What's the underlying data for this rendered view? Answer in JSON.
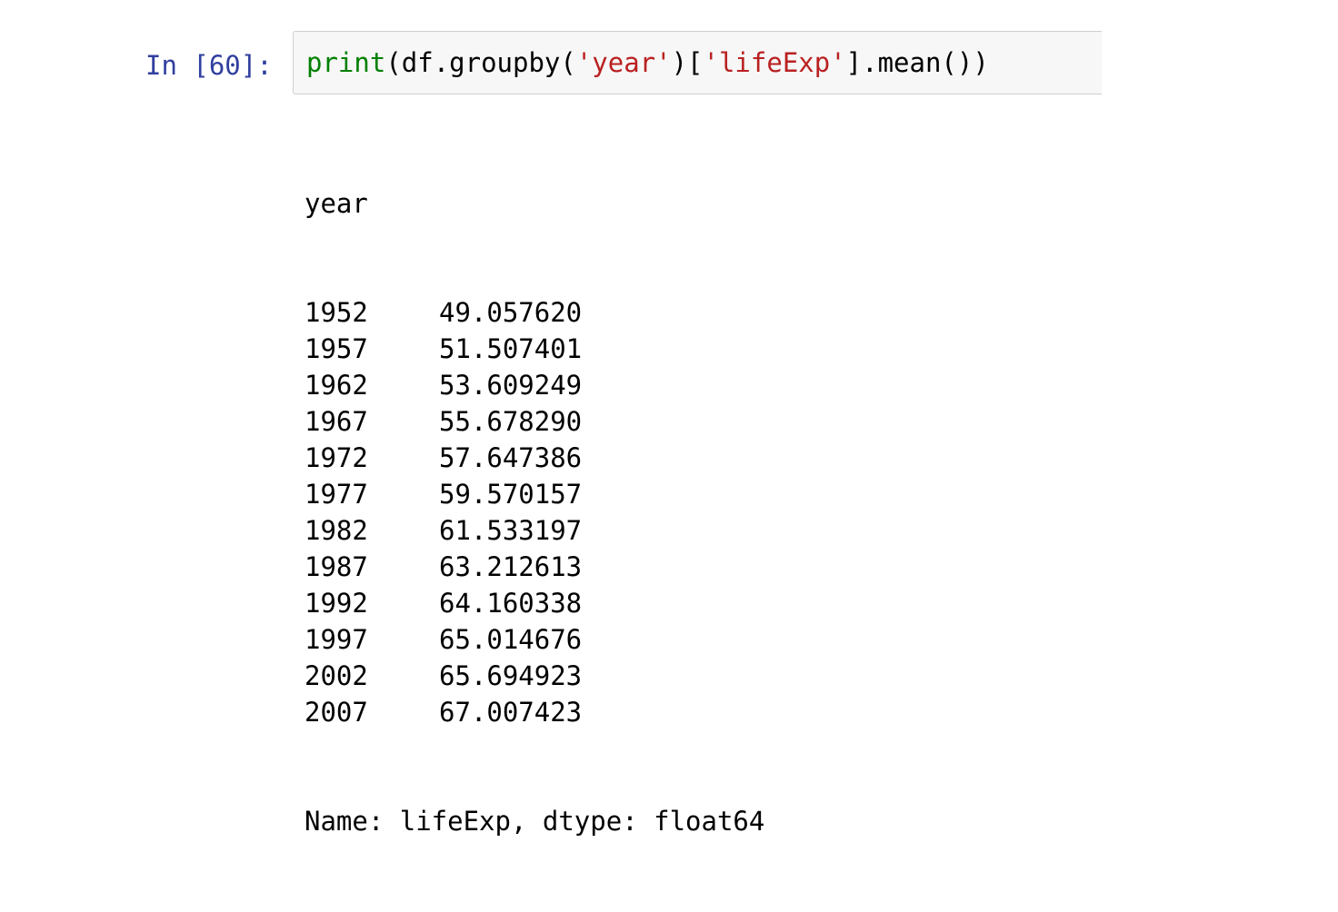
{
  "cell": {
    "prompt": "In [60]:",
    "code": {
      "fn": "print",
      "part1": "(df.groupby(",
      "str1": "'year'",
      "part2": ")[",
      "str2": "'lifeExp'",
      "part3": "].mean())"
    }
  },
  "output": {
    "header": "year",
    "rows": [
      {
        "year": "1952",
        "value": "49.057620"
      },
      {
        "year": "1957",
        "value": "51.507401"
      },
      {
        "year": "1962",
        "value": "53.609249"
      },
      {
        "year": "1967",
        "value": "55.678290"
      },
      {
        "year": "1972",
        "value": "57.647386"
      },
      {
        "year": "1977",
        "value": "59.570157"
      },
      {
        "year": "1982",
        "value": "61.533197"
      },
      {
        "year": "1987",
        "value": "63.212613"
      },
      {
        "year": "1992",
        "value": "64.160338"
      },
      {
        "year": "1997",
        "value": "65.014676"
      },
      {
        "year": "2002",
        "value": "65.694923"
      },
      {
        "year": "2007",
        "value": "67.007423"
      }
    ],
    "footer": "Name: lifeExp, dtype: float64"
  },
  "colors": {
    "prompt": "#303f9f",
    "builtin": "#008000",
    "string": "#ba2121",
    "input_bg": "#f7f7f7",
    "input_border": "#d0d0d0"
  }
}
